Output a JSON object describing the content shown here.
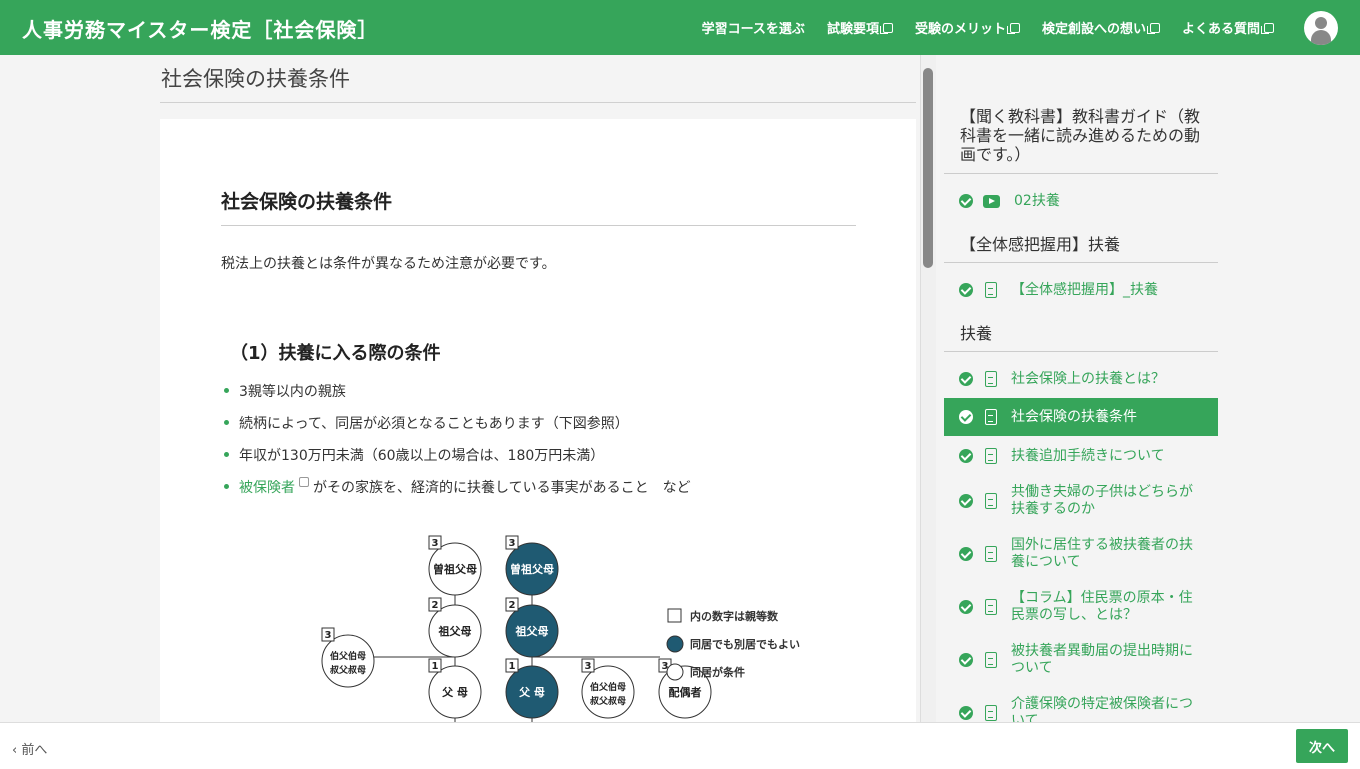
{
  "header": {
    "brand": "人事労務マイスター検定［社会保険］",
    "nav": [
      {
        "label": "学習コースを選ぶ",
        "external": false
      },
      {
        "label": "試験要項",
        "external": true
      },
      {
        "label": "受験のメリット",
        "external": true
      },
      {
        "label": "検定創設への想い",
        "external": true
      },
      {
        "label": "よくある質問",
        "external": true
      }
    ]
  },
  "main": {
    "page_title": "社会保険の扶養条件",
    "heading": "社会保険の扶養条件",
    "intro": "税法上の扶養とは条件が異なるため注意が必要です。",
    "section_heading": "（1）扶養に入る際の条件",
    "bullets": [
      "3親等以内の親族",
      "続柄によって、同居が必須となることもあります（下図参照）",
      "年収が130万円未満（60歳以上の場合は、180万円未満）"
    ],
    "bullet4_link": "被保険者",
    "bullet4_rest": "がその家族を、経済的に扶養している事実があること　など"
  },
  "diagram": {
    "legend": [
      "内の数字は親等数",
      "同居でも別居でもよい",
      "同居が条件"
    ],
    "nodes": [
      {
        "id": "n1",
        "label": "曽祖父母",
        "degree": "3",
        "filled": false
      },
      {
        "id": "n2",
        "label": "曽祖父母",
        "degree": "3",
        "filled": true
      },
      {
        "id": "n3",
        "label": "祖父母",
        "degree": "2",
        "filled": false
      },
      {
        "id": "n4",
        "label": "祖父母",
        "degree": "2",
        "filled": true
      },
      {
        "id": "n5",
        "label": "伯父伯母",
        "label2": "叔父叔母",
        "degree": "3",
        "filled": false
      },
      {
        "id": "n6",
        "label": "父 母",
        "degree": "1",
        "filled": false
      },
      {
        "id": "n7",
        "label": "父 母",
        "degree": "1",
        "filled": true
      },
      {
        "id": "n8",
        "label": "伯父伯母",
        "label2": "叔父叔母",
        "degree": "3",
        "filled": false
      },
      {
        "id": "n9",
        "label": "配偶者",
        "degree": "3",
        "filled": false
      }
    ]
  },
  "sidebar": {
    "sections": [
      {
        "title": "【聞く教科書】教科書ガイド（教科書を一緒に読み進めるための動画です。）"
      },
      {
        "title": "【全体感把握用】扶養"
      },
      {
        "title": "扶養"
      }
    ],
    "lessons": [
      {
        "label": "02扶養",
        "icon": "video-icon"
      },
      {
        "label": "【全体感把握用】_扶養",
        "icon": "document-icon"
      },
      {
        "label": "社会保険上の扶養とは？",
        "icon": "document-icon"
      },
      {
        "label": "社会保険の扶養条件",
        "icon": "document-icon",
        "active": true
      },
      {
        "label": "扶養追加手続きについて",
        "icon": "document-icon"
      },
      {
        "label": "共働き夫婦の子供はどちらが扶養するのか",
        "icon": "document-icon"
      },
      {
        "label": "国外に居住する被扶養者の扶養について",
        "icon": "document-icon"
      },
      {
        "label": "【コラム】住民票の原本・住民票の写し、とは？",
        "icon": "document-icon"
      },
      {
        "label": "被扶養者異動届の提出時期について",
        "icon": "document-icon"
      },
      {
        "label": "介護保険の特定被保険者について",
        "icon": "document-icon"
      }
    ]
  },
  "footer": {
    "prev": "前へ",
    "next": "次へ"
  },
  "colors": {
    "brand": "#36a55a",
    "node_fill": "#1f5a72"
  }
}
